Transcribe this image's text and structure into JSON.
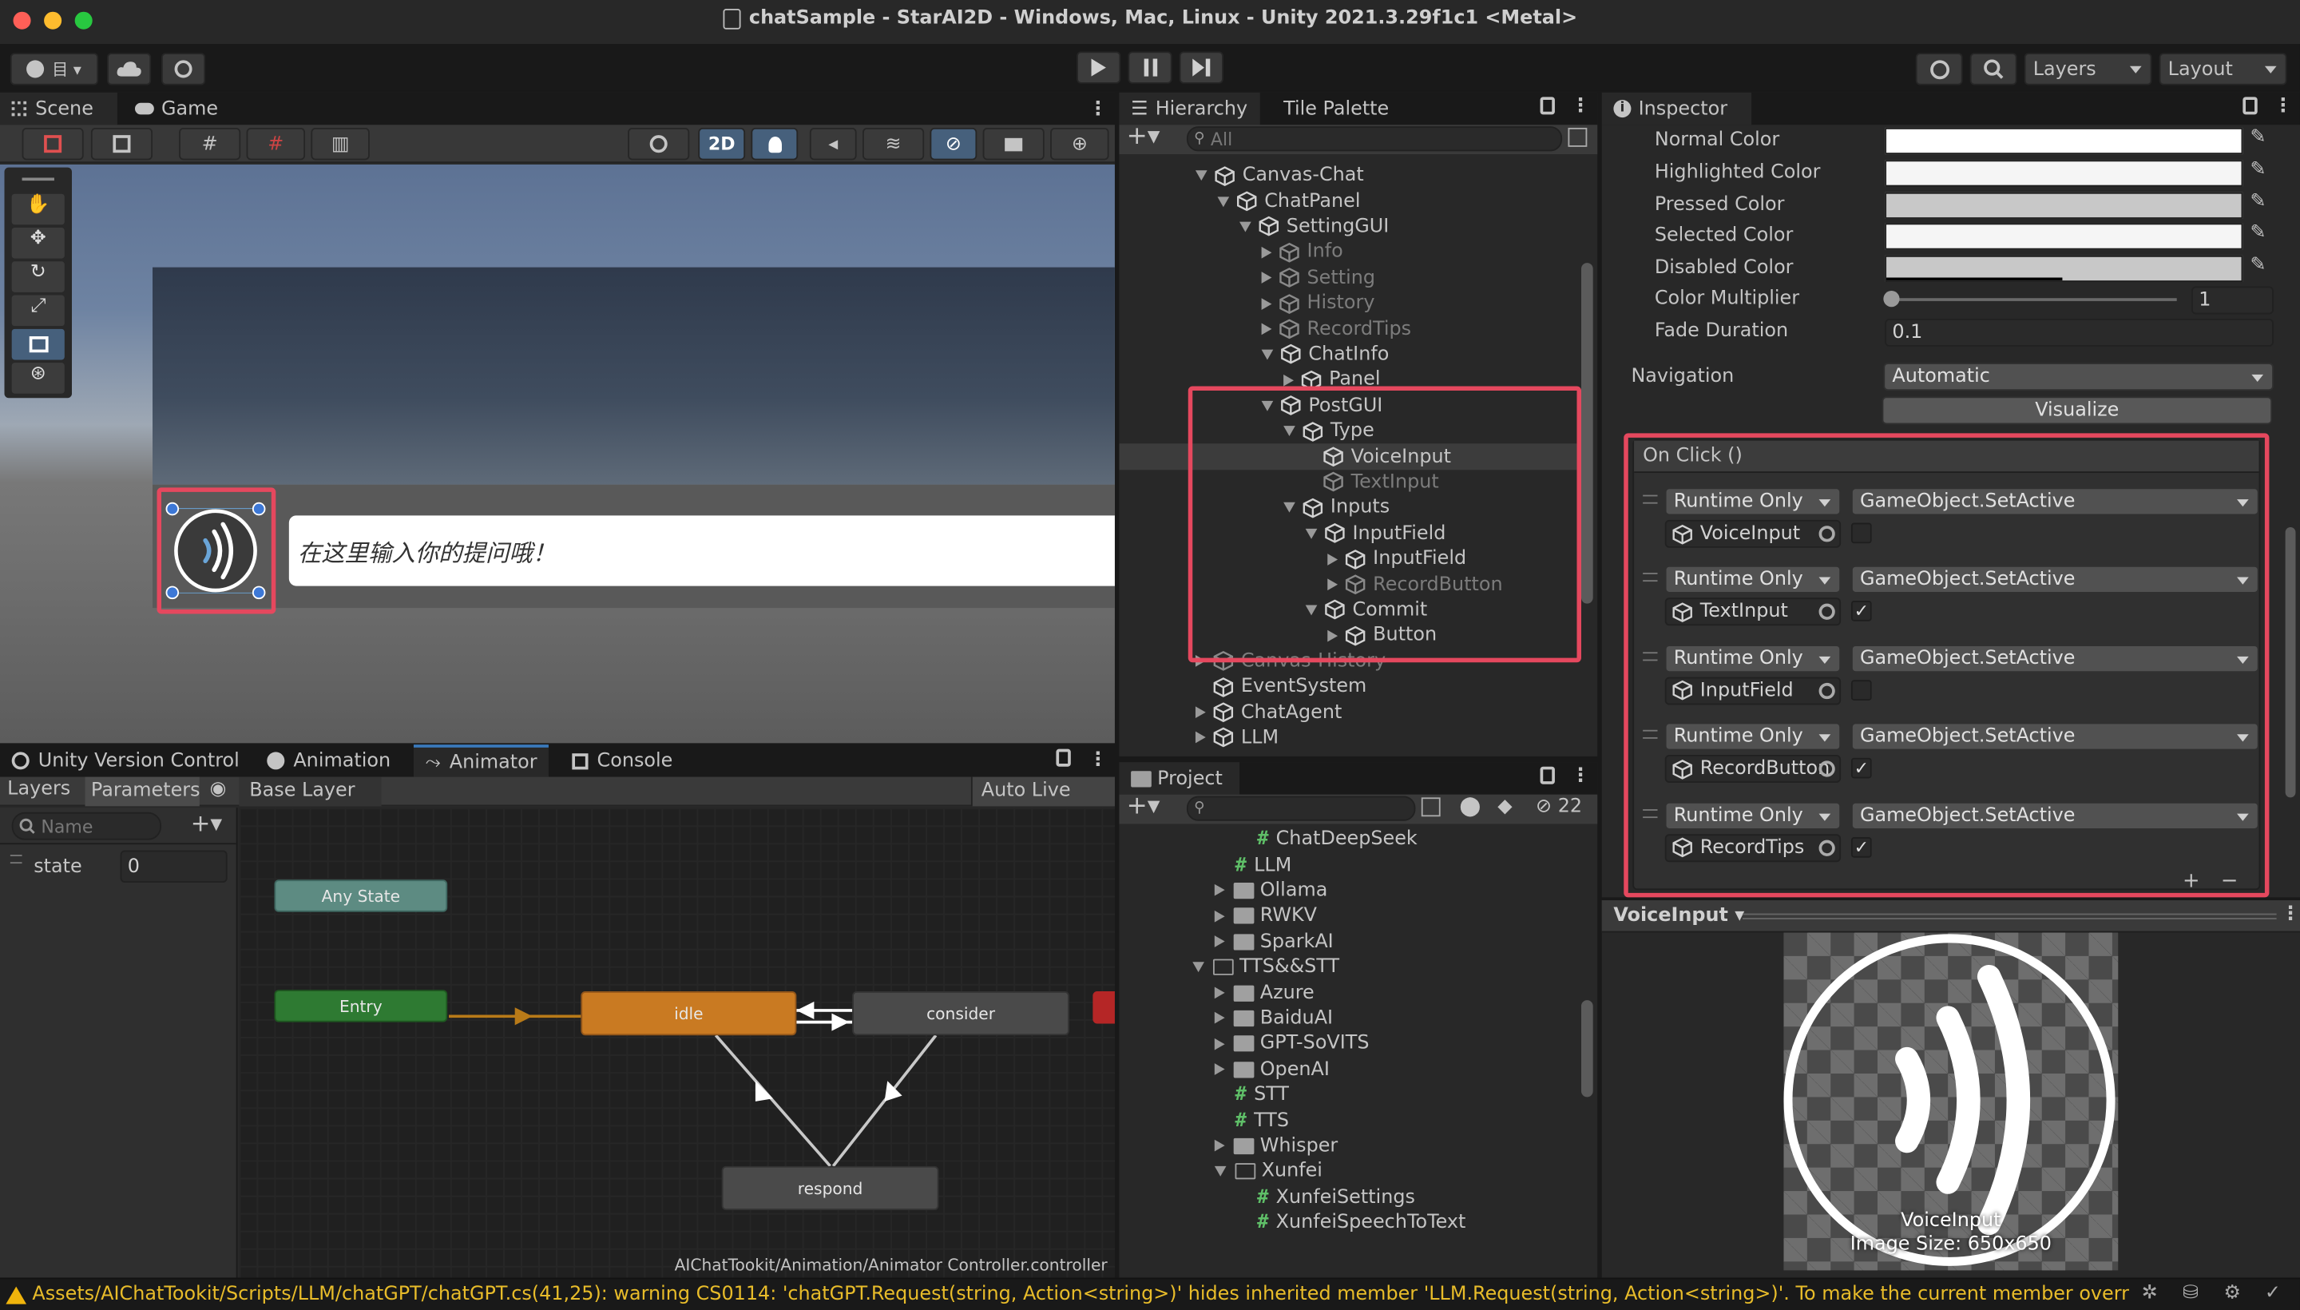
{
  "window": {
    "title": "chatSample - StarAI2D - Windows, Mac, Linux - Unity 2021.3.29f1c1 <Metal>"
  },
  "toolbar": {
    "layers_label": "Layers",
    "layout_label": "Layout"
  },
  "scene": {
    "tabs": [
      "Scene",
      "Game"
    ],
    "mode_2d_label": "2D",
    "input_placeholder": "在这里输入你的提问哦！"
  },
  "hierarchy": {
    "tabs": [
      "Hierarchy",
      "Tile Palette"
    ],
    "search_placeholder": "All",
    "items": [
      {
        "label": "Canvas-Chat",
        "indent": 0,
        "arrow": "down",
        "dim": false
      },
      {
        "label": "ChatPanel",
        "indent": 1,
        "arrow": "down",
        "dim": false
      },
      {
        "label": "SettingGUI",
        "indent": 2,
        "arrow": "down",
        "dim": false
      },
      {
        "label": "Info",
        "indent": 3,
        "arrow": "right",
        "dim": true
      },
      {
        "label": "Setting",
        "indent": 3,
        "arrow": "right",
        "dim": true
      },
      {
        "label": "History",
        "indent": 3,
        "arrow": "right",
        "dim": true
      },
      {
        "label": "RecordTips",
        "indent": 3,
        "arrow": "right",
        "dim": true
      },
      {
        "label": "ChatInfo",
        "indent": 3,
        "arrow": "down",
        "dim": false
      },
      {
        "label": "Panel",
        "indent": 4,
        "arrow": "right",
        "dim": false
      },
      {
        "label": "PostGUI",
        "indent": 3,
        "arrow": "down",
        "dim": false
      },
      {
        "label": "Type",
        "indent": 4,
        "arrow": "down",
        "dim": false
      },
      {
        "label": "VoiceInput",
        "indent": 5,
        "arrow": "none",
        "dim": false
      },
      {
        "label": "TextInput",
        "indent": 5,
        "arrow": "none",
        "dim": true
      },
      {
        "label": "Inputs",
        "indent": 4,
        "arrow": "down",
        "dim": false
      },
      {
        "label": "InputField",
        "indent": 5,
        "arrow": "down",
        "dim": false
      },
      {
        "label": "InputField",
        "indent": 6,
        "arrow": "right",
        "dim": false
      },
      {
        "label": "RecordButton",
        "indent": 6,
        "arrow": "right",
        "dim": true
      },
      {
        "label": "Commit",
        "indent": 5,
        "arrow": "down",
        "dim": false
      },
      {
        "label": "Button",
        "indent": 6,
        "arrow": "right",
        "dim": false
      },
      {
        "label": "Canvas-History",
        "indent": 0,
        "arrow": "right",
        "dim": true
      },
      {
        "label": "EventSystem",
        "indent": 0,
        "arrow": "none",
        "dim": false
      },
      {
        "label": "ChatAgent",
        "indent": 0,
        "arrow": "right",
        "dim": false
      },
      {
        "label": "LLM",
        "indent": 0,
        "arrow": "right",
        "dim": false
      }
    ]
  },
  "inspector": {
    "tab": "Inspector",
    "colors": [
      {
        "label": "Normal Color",
        "swatch": "#ffffff"
      },
      {
        "label": "Highlighted Color",
        "swatch": "#f5f5f5"
      },
      {
        "label": "Pressed Color",
        "swatch": "#c8c8c8"
      },
      {
        "label": "Selected Color",
        "swatch": "#f5f5f5"
      },
      {
        "label": "Disabled Color",
        "swatch": "#c8c8c8"
      }
    ],
    "color_multiplier_label": "Color Multiplier",
    "color_multiplier_value": "1",
    "fade_duration_label": "Fade Duration",
    "fade_duration_value": "0.1",
    "navigation_label": "Navigation",
    "navigation_value": "Automatic",
    "visualize_label": "Visualize",
    "onclick_title": "On Click ()",
    "events": [
      {
        "mode": "Runtime Only",
        "func": "GameObject.SetActive",
        "target": "VoiceInput",
        "checked": false
      },
      {
        "mode": "Runtime Only",
        "func": "GameObject.SetActive",
        "target": "TextInput",
        "checked": true
      },
      {
        "mode": "Runtime Only",
        "func": "GameObject.SetActive",
        "target": "InputField",
        "checked": false
      },
      {
        "mode": "Runtime Only",
        "func": "GameObject.SetActive",
        "target": "RecordButton",
        "checked": true
      },
      {
        "mode": "Runtime Only",
        "func": "GameObject.SetActive",
        "target": "RecordTips",
        "checked": true
      }
    ],
    "preview_title": "VoiceInput",
    "preview_name": "VoiceInput",
    "preview_size": "Image Size: 650x650"
  },
  "animator": {
    "tabs": [
      "Unity Version Control",
      "Animation",
      "Animator",
      "Console"
    ],
    "subtabs": [
      "Layers",
      "Parameters"
    ],
    "base_layer": "Base Layer",
    "auto_live_link": "Auto Live Link",
    "name_placeholder": "Name",
    "param_name": "state",
    "param_value": "0",
    "nodes": {
      "any_state": "Any State",
      "entry": "Entry",
      "idle": "idle",
      "consider": "consider",
      "respond": "respond"
    },
    "controller_path": "AIChatTookit/Animation/Animator Controller.controller"
  },
  "project": {
    "tab": "Project",
    "hidden_count": "22",
    "items": [
      {
        "label": "ChatDeepSeek",
        "type": "script",
        "indent": 2
      },
      {
        "label": "LLM",
        "type": "script",
        "indent": 1
      },
      {
        "label": "Ollama",
        "type": "folder",
        "indent": 1
      },
      {
        "label": "RWKV",
        "type": "folder",
        "indent": 1
      },
      {
        "label": "SparkAI",
        "type": "folder",
        "indent": 1
      },
      {
        "label": "TTS&&STT",
        "type": "folder-open",
        "indent": 0
      },
      {
        "label": "Azure",
        "type": "folder",
        "indent": 1
      },
      {
        "label": "BaiduAI",
        "type": "folder",
        "indent": 1
      },
      {
        "label": "GPT-SoVITS",
        "type": "folder",
        "indent": 1
      },
      {
        "label": "OpenAI",
        "type": "folder",
        "indent": 1
      },
      {
        "label": "STT",
        "type": "script",
        "indent": 1
      },
      {
        "label": "TTS",
        "type": "script",
        "indent": 1
      },
      {
        "label": "Whisper",
        "type": "folder",
        "indent": 1
      },
      {
        "label": "Xunfei",
        "type": "folder-open",
        "indent": 1
      },
      {
        "label": "XunfeiSettings",
        "type": "script",
        "indent": 2
      },
      {
        "label": "XunfeiSpeechToText",
        "type": "script",
        "indent": 2
      }
    ]
  },
  "status": {
    "message": "Assets/AIChatTookit/Scripts/LLM/chatGPT/chatGPT.cs(41,25): warning CS0114: 'chatGPT.Request(string, Action<string>)' hides inherited member 'LLM.Request(string, Action<string>)'. To make the current member override that"
  },
  "colors": {
    "highlight": "#e5485e",
    "accent": "#2c5d87"
  }
}
